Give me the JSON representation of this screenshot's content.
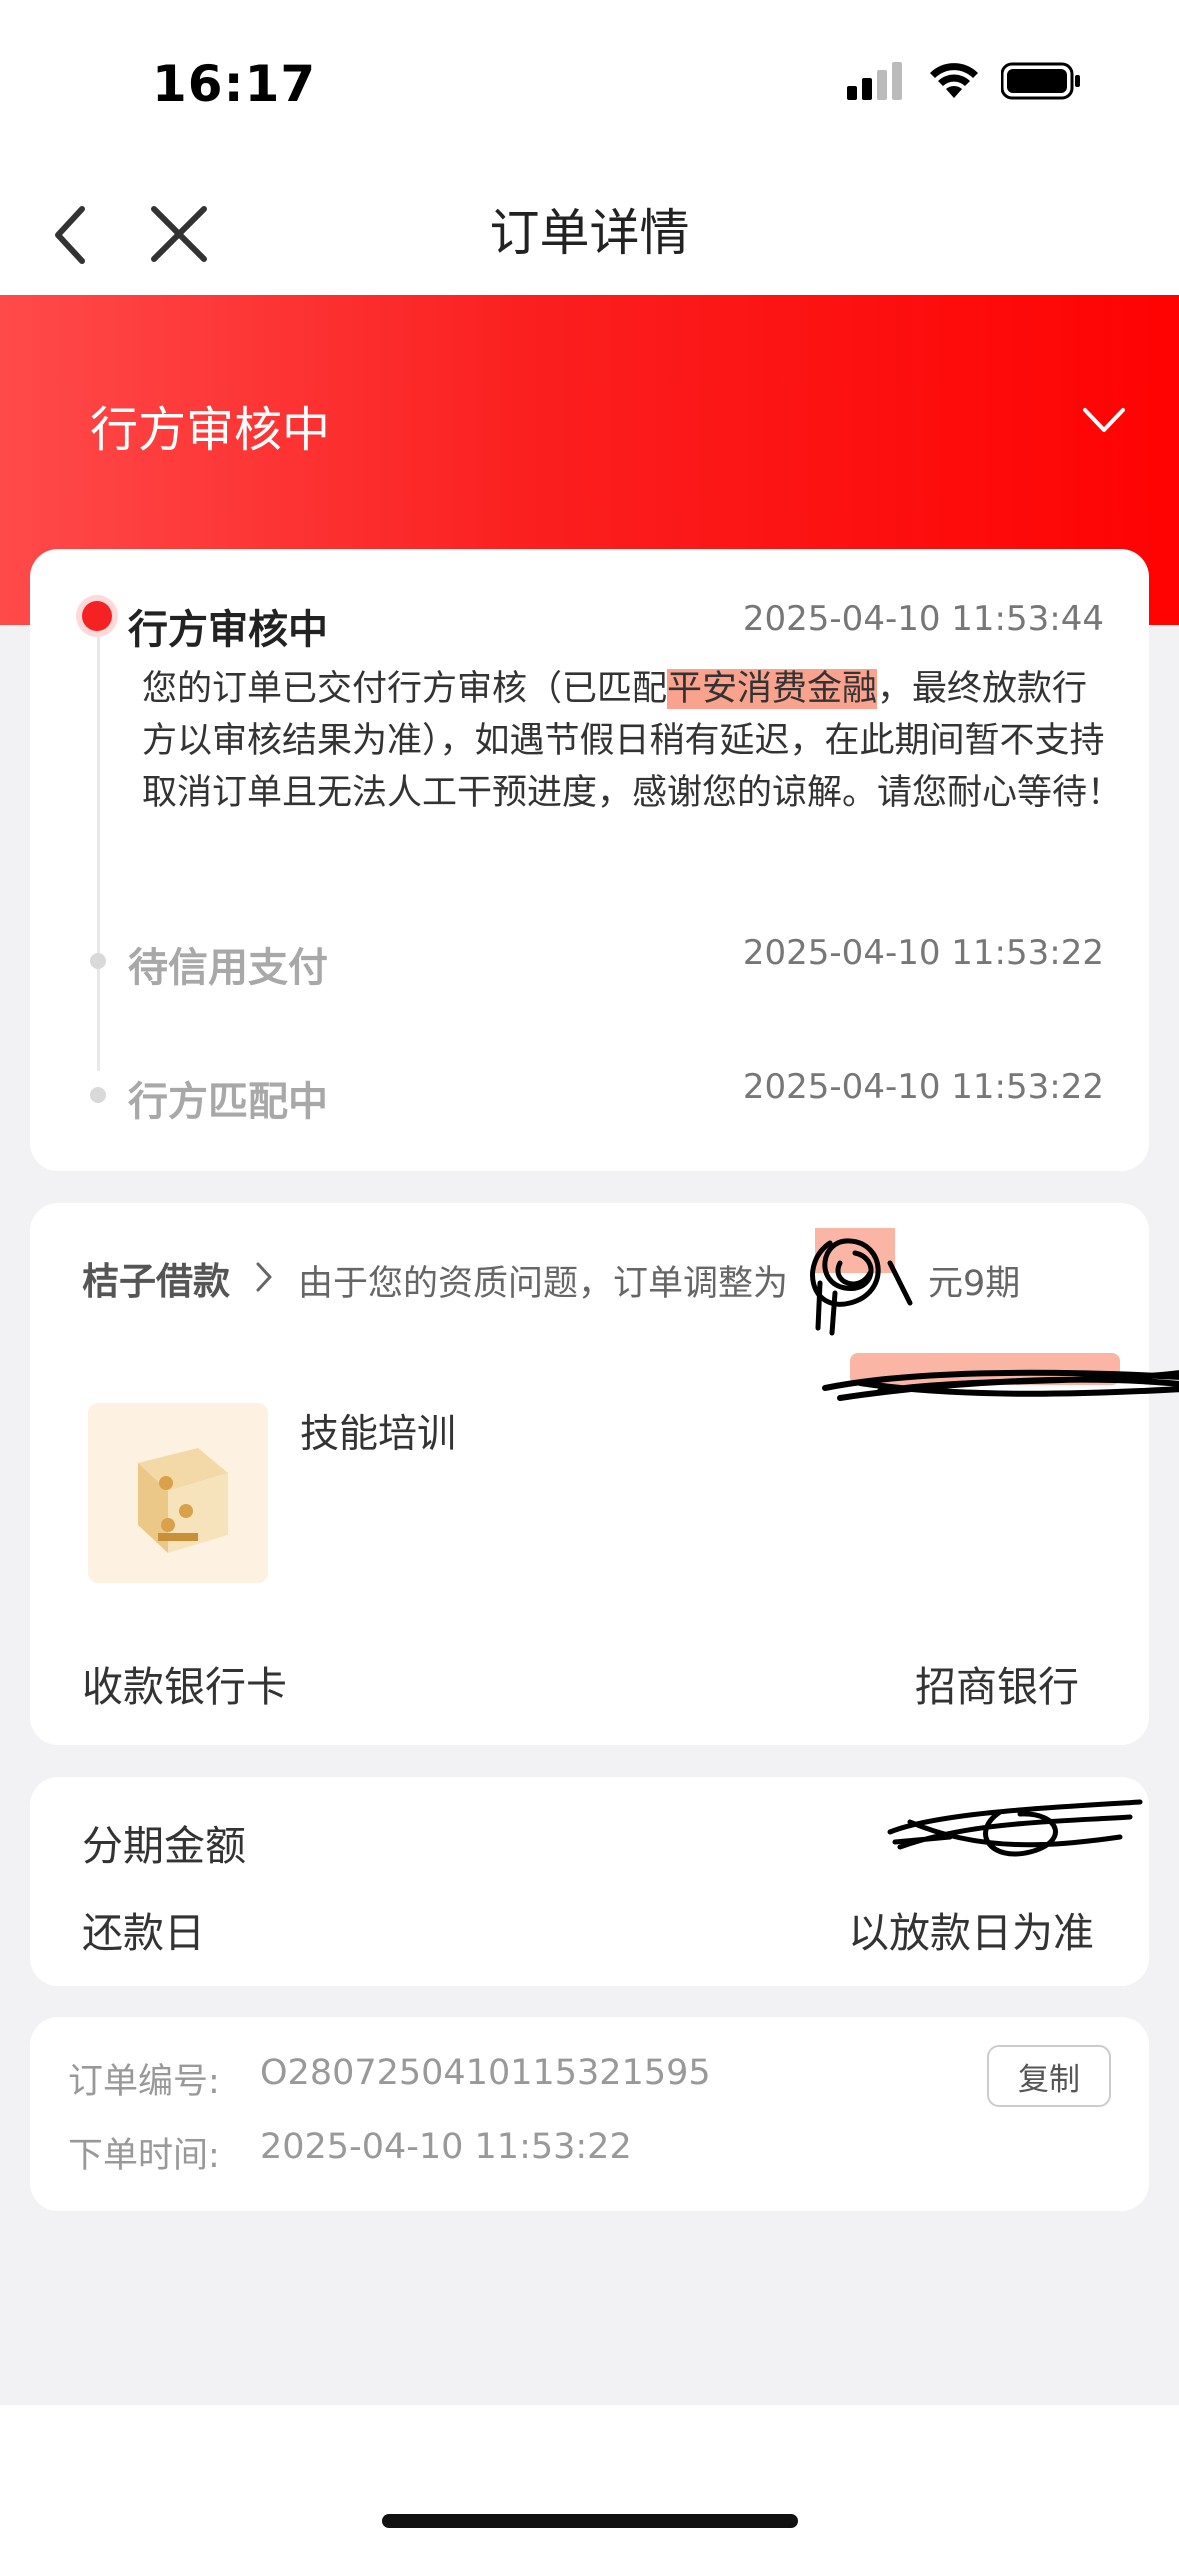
{
  "status_bar": {
    "time": "16:17"
  },
  "nav": {
    "title": "订单详情"
  },
  "hero": {
    "title": "行方审核中"
  },
  "timeline": [
    {
      "label": "行方审核中",
      "time": "2025-04-10 11:53:44",
      "description_before": "您的订单已交付行方审核（已匹配",
      "description_highlight": "平安消费金融",
      "description_after": "，最终放款行方以审核结果为准），如遇节假日稍有延迟，在此期间暂不支持取消订单且无法人工干预进度，感谢您的谅解。请您耐心等待！"
    },
    {
      "label": "待信用支付",
      "time": "2025-04-10 11:53:22"
    },
    {
      "label": "行方匹配中",
      "time": "2025-04-10 11:53:22"
    }
  ],
  "loan": {
    "brand": "桔子借款",
    "notice_before": "由于您的资质问题，订单调整为",
    "notice_after": "元9期",
    "product_name": "技能培训",
    "bank_label": "收款银行卡",
    "bank_value": "招商银行"
  },
  "amount": {
    "installment_label": "分期金额",
    "repay_label": "还款日",
    "repay_value": "以放款日为准"
  },
  "order": {
    "number_label": "订单编号:",
    "number_value": "O2807250410115321595",
    "copy_label": "复制",
    "time_label": "下单时间:",
    "time_value": "2025-04-10 11:53:22"
  },
  "colors": {
    "brand_red": "#ff2a2a",
    "highlight": "#f9a28d"
  }
}
